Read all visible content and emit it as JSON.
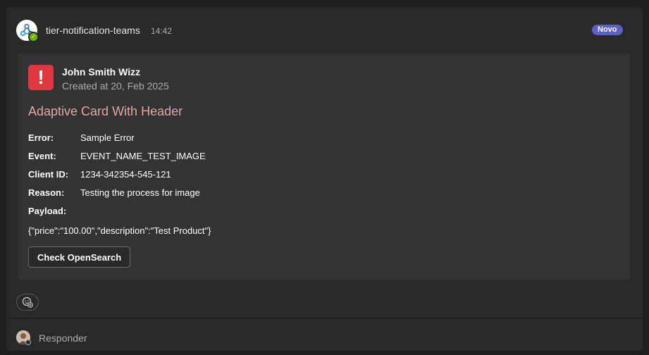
{
  "message": {
    "sender": "tier-notification-teams",
    "time": "14:42",
    "badge": "Novo",
    "avatar_icon": "webhook-icon",
    "presence_status": "available"
  },
  "card": {
    "alert_icon_symbol": "!",
    "author": "John Smith Wizz",
    "created": "Created at 20, Feb 2025",
    "title": "Adaptive Card With Header",
    "facts": [
      {
        "key": "Error:",
        "value": "Sample Error"
      },
      {
        "key": "Event:",
        "value": "EVENT_NAME_TEST_IMAGE"
      },
      {
        "key": "Client ID:",
        "value": "1234-342354-545-121"
      },
      {
        "key": "Reason:",
        "value": "Testing the process for image"
      }
    ],
    "payload_label": "Payload:",
    "payload_value": "{\"price\":\"100.00\",\"description\":\"Test Product\"}",
    "action_label": "Check OpenSearch"
  },
  "reactions": {
    "add_reaction_icon": "add-emoji-icon"
  },
  "reply": {
    "label": "Responder"
  },
  "colors": {
    "badge": "#5b5fc7",
    "alert": "#e0383e",
    "title": "#e3a6aa",
    "presence": "#6bb700"
  }
}
